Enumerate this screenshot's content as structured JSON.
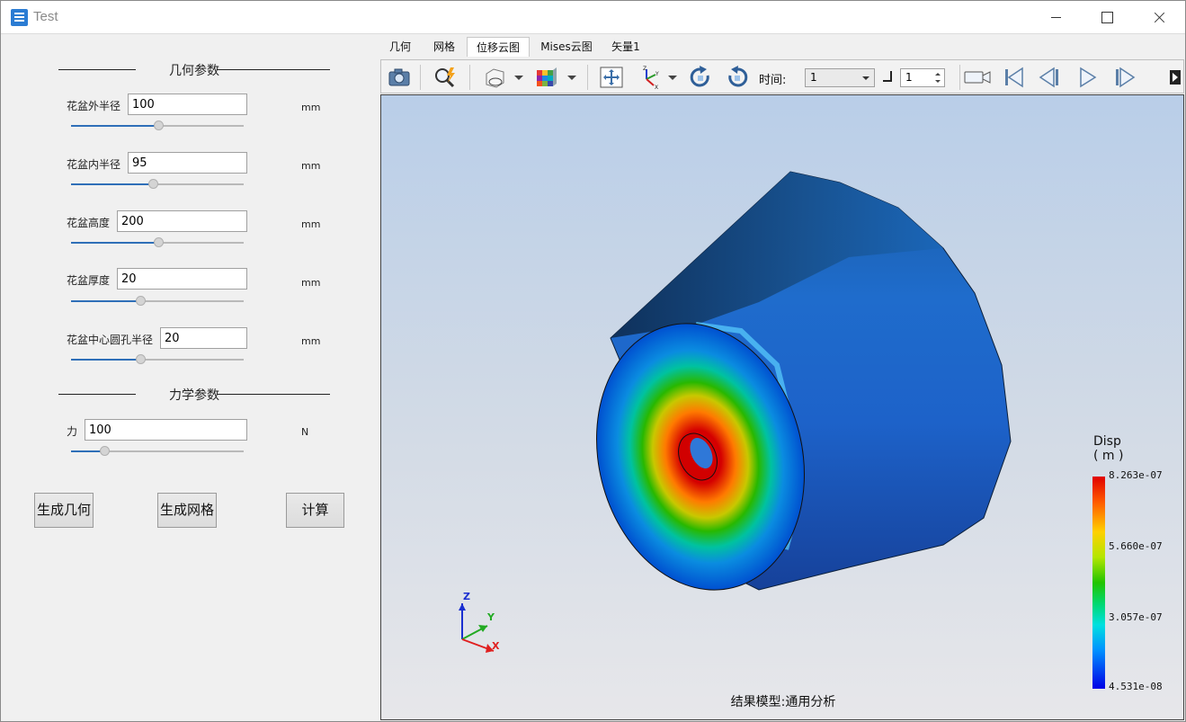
{
  "window": {
    "title": "Test"
  },
  "geometry_section": {
    "title": "几何参数",
    "params": [
      {
        "label": "花盆外半径",
        "value": "100",
        "unit": "mm",
        "slider_pct": 0.5
      },
      {
        "label": "花盆内半径",
        "value": "95",
        "unit": "mm",
        "slider_pct": 0.47
      },
      {
        "label": "花盆高度",
        "value": "200",
        "unit": "mm",
        "slider_pct": 0.5
      },
      {
        "label": "花盆厚度",
        "value": "20",
        "unit": "mm",
        "slider_pct": 0.4
      },
      {
        "label": "花盆中心圆孔半径",
        "value": "20",
        "unit": "mm",
        "slider_pct": 0.4
      }
    ]
  },
  "mechanics_section": {
    "title": "力学参数",
    "params": [
      {
        "label": "力",
        "value": "100",
        "unit": "N",
        "slider_pct": 0.19
      }
    ]
  },
  "buttons": {
    "generate_geometry": "生成几何",
    "generate_mesh": "生成网格",
    "compute": "计算"
  },
  "tabs": [
    "几何",
    "网格",
    "位移云图",
    "Mises云图",
    "矢量1"
  ],
  "active_tab_index": 2,
  "toolbar": {
    "icons": [
      "camera-icon",
      "zoom-icon",
      "display-mode-icon",
      "color-cube-icon",
      "fit-view-icon",
      "axis-icon",
      "rotate-cw-icon",
      "rotate-ccw-icon",
      "record-icon",
      "first-frame-icon",
      "prev-frame-icon",
      "play-icon",
      "next-frame-icon"
    ],
    "time_label": "时间:",
    "time_value": "1",
    "step_value": "1"
  },
  "viewport": {
    "result_label": "结果模型:通用分析",
    "legend": {
      "title": "Disp",
      "unit": "( m )",
      "values": [
        "8.263e-07",
        "5.660e-07",
        "3.057e-07",
        "4.531e-08"
      ]
    },
    "triad": {
      "x": "X",
      "y": "Y",
      "z": "Z"
    }
  },
  "colors": {
    "accent": "#2f6fb8",
    "background": "#f0f0f0"
  }
}
